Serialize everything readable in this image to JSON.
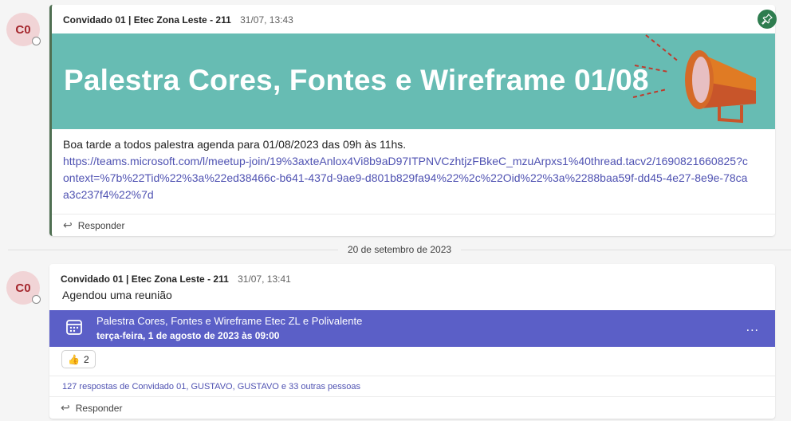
{
  "post1": {
    "avatar_initials": "C0",
    "author": "Convidado 01 | Etec Zona Leste - 211",
    "time": "31/07, 13:43",
    "banner_title": "Palestra Cores, Fontes e Wireframe 01/08",
    "body_text": "Boa tarde a todos palestra agenda para 01/08/2023 das 09h às 11hs.",
    "link": "https://teams.microsoft.com/l/meetup-join/19%3axteAnlox4Vi8b9aD97ITPNVCzhtjzFBkeC_mzuArpxs1%40thread.tacv2/1690821660825?context=%7b%22Tid%22%3a%22ed38466c-b641-437d-9ae9-d801b829fa94%22%2c%22Oid%22%3a%2288baa59f-dd45-4e27-8e9e-78caa3c237f4%22%7d",
    "reply_label": "Responder"
  },
  "date_separator": "20 de setembro de 2023",
  "post2": {
    "avatar_initials": "C0",
    "author": "Convidado 01 | Etec Zona Leste - 211",
    "time": "31/07, 13:41",
    "text": "Agendou uma reunião",
    "meeting": {
      "title": "Palestra Cores, Fontes e Wireframe Etec ZL e Polivalente",
      "date": "terça-feira, 1 de agosto de 2023 às 09:00",
      "more": "..."
    },
    "reaction": {
      "emoji": "👍",
      "count": "2"
    },
    "replies_summary": "127 respostas de Convidado 01, GUSTAVO, GUSTAVO e 33 outras pessoas",
    "reply_label": "Responder"
  },
  "colors": {
    "banner_bg": "#67bcb3",
    "meeting_bg": "#5b5fc7",
    "link": "#4f52b2",
    "avatar_bg": "#f1d4d6",
    "avatar_text": "#a4262c",
    "pin_bg": "#2e7d4f"
  },
  "icons": {
    "pin": "pin-icon",
    "reply": "reply-arrow-icon",
    "calendar": "calendar-icon",
    "megaphone": "megaphone-icon"
  }
}
